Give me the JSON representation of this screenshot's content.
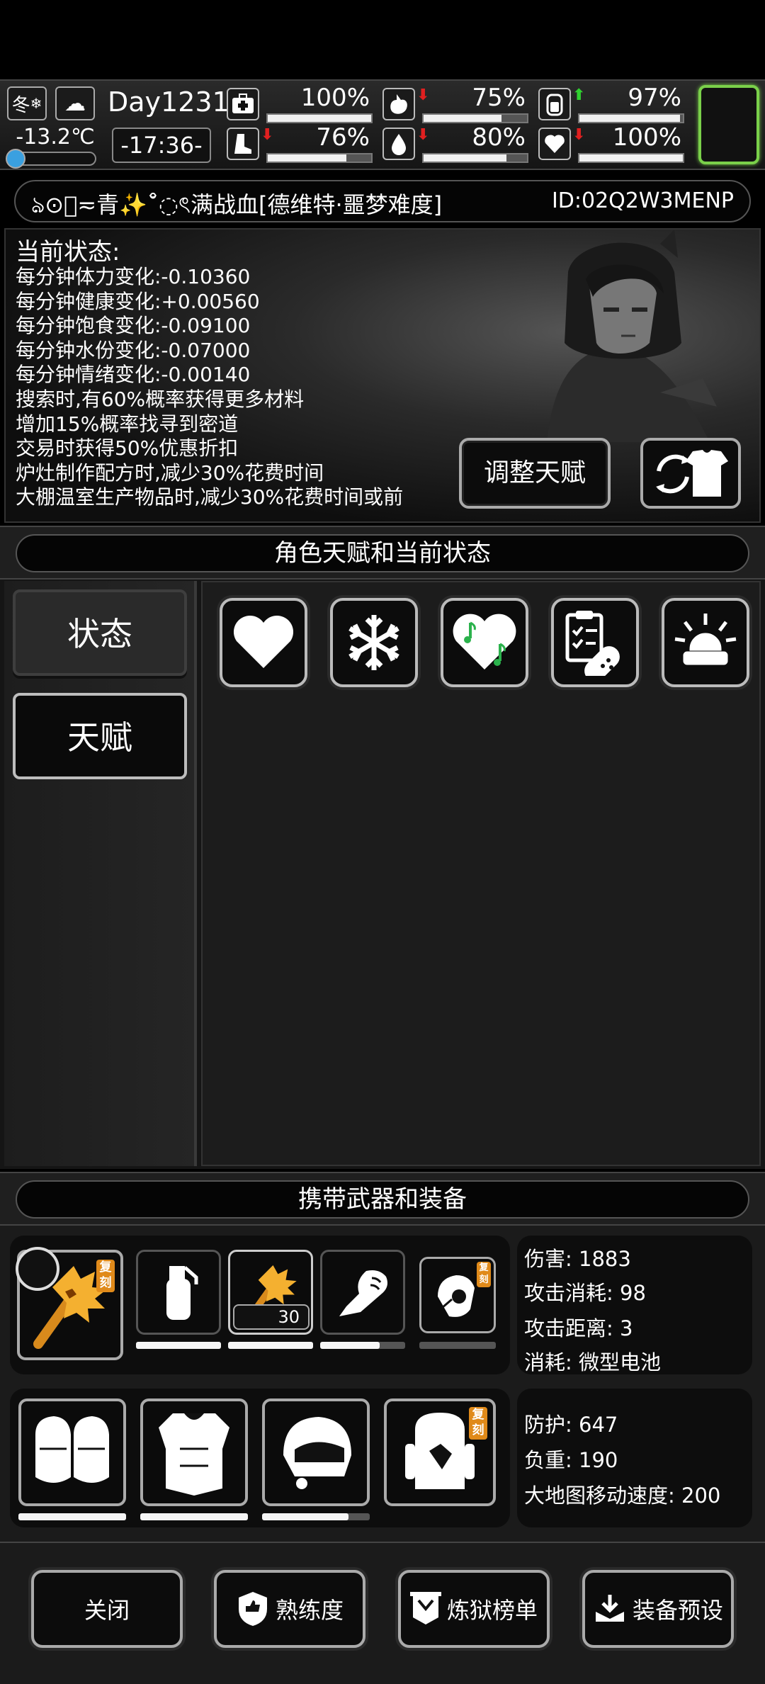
{
  "hud": {
    "season": "冬",
    "temperature": "-13.2℃",
    "day": "Day1231",
    "time": "-17:36-",
    "stats": [
      {
        "key": "health",
        "icon": "medkit-icon",
        "value": "100%",
        "level": 1.0,
        "trend": "none"
      },
      {
        "key": "hunger",
        "icon": "stomach-icon",
        "value": "75%",
        "level": 0.75,
        "trend": "down"
      },
      {
        "key": "energy",
        "icon": "battery-icon",
        "value": "97%",
        "level": 0.97,
        "trend": "up"
      },
      {
        "key": "stamina",
        "icon": "boot-icon",
        "value": "76%",
        "level": 0.76,
        "trend": "down"
      },
      {
        "key": "water",
        "icon": "water-drop-icon",
        "value": "80%",
        "level": 0.8,
        "trend": "down"
      },
      {
        "key": "mood",
        "icon": "heart-icon",
        "value": "100%",
        "level": 1.0,
        "trend": "down"
      }
    ],
    "arrow_down": "⬇",
    "arrow_up": "⬆",
    "temp_level": 0.1
  },
  "player": {
    "name": "ঌ⊙ি≂青✨˚̆◌ৎ满战血[德维特·噩梦难度]",
    "id": "ID:02Q2W3MENP"
  },
  "status": {
    "title": "当前状态:",
    "lines": [
      "每分钟体力变化:-0.10360",
      "每分钟健康变化:+0.00560",
      "每分钟饱食变化:-0.09100",
      "每分钟水份变化:-0.07000",
      "每分钟情绪变化:-0.00140",
      "搜索时,有60%概率获得更多材料",
      "增加15%概率找寻到密道",
      "交易时获得50%优惠折扣",
      "炉灶制作配方时,减少30%花费时间",
      "大棚温室生产物品时,减少30%花费时间或前"
    ],
    "adjust_button": "调整天赋"
  },
  "talent_section": {
    "header": "角色天赋和当前状态",
    "tabs": [
      "状态",
      "天赋"
    ],
    "icons": [
      "heart-icon",
      "snowflake-icon",
      "music-heart-icon",
      "clipboard-pill-icon",
      "alarm-light-icon"
    ]
  },
  "equipment": {
    "header": "携带武器和装备",
    "weapon_stats": [
      "伤害: 1883",
      "攻击消耗: 98",
      "攻击距离: 3",
      "消耗: 微型电池"
    ],
    "armor_stats": [
      "防护: 647",
      "负重: 190",
      "大地图移动速度: 200"
    ],
    "weapon_count": "30",
    "copy_tag": "复刻",
    "weapon_durability": [
      1.0,
      1.0,
      0.7,
      0.0,
      1.0
    ],
    "armor_durability": [
      1.0,
      1.0,
      0.8
    ]
  },
  "bottom_buttons": [
    "关闭",
    "熟练度",
    "炼狱榜单",
    "装备预设"
  ]
}
